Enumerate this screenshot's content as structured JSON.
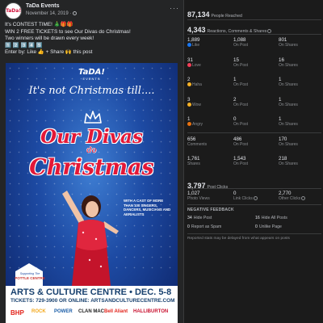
{
  "post": {
    "page_name": "TaDa Events",
    "avatar_text": "TaDa!",
    "date": "November 14, 2019 ·",
    "more": "···",
    "text_lines": [
      "It's CONTEST TIME! 🎄🎁🎁",
      "WIN 2 FREE TICKETS to see Our Divas do Christmas!",
      "Two winners will be drawn every week!",
      "1️⃣ 2️⃣ 3️⃣ 4️⃣ 5️⃣",
      "Enter by: Like 👍 + Share 🙌 this post"
    ]
  },
  "poster": {
    "logo": "TaDA!",
    "logo_sub": "EVENTS",
    "tagline": "It's not Christmas till....",
    "title_line1": "Our Divas",
    "title_line2": "do",
    "title_line3": "Christmas",
    "cast": "With a cast of more than 100 singers, dancers, musicians and aerialists",
    "support_label": "Supporting The",
    "sponsor_name": "POTTLE CENTRE",
    "venue": "ARTS & CULTURE CENTRE • DEC. 5-8",
    "tickets": "TICKETS: 729-3900 OR ONLINE: ARTSANDCULTURECENTRE.COM",
    "sponsors": [
      "BHP",
      "ROCK",
      "POWER",
      "CLAN MAC",
      "Bell Aliant",
      "HALLIBURTON"
    ],
    "colors": {
      "title_red": "#e31837",
      "navy": "#17406e",
      "sky_top": "#3f7fd4"
    }
  },
  "insights": {
    "people_reached": {
      "value": "87,134",
      "label": "People Reached"
    },
    "reactions": {
      "value": "4,343",
      "label": "Reactions, Comments & Shares"
    },
    "reaction_rows": [
      {
        "icon": "like-icon",
        "color": "#1877f2",
        "total": "1,889",
        "total_label": "Like",
        "on_post": "1,088",
        "on_post_label": "On Post",
        "on_shares": "801",
        "on_shares_label": "On Shares"
      },
      {
        "icon": "love-icon",
        "color": "#f33e58",
        "total": "31",
        "total_label": "Love",
        "on_post": "15",
        "on_post_label": "On Post",
        "on_shares": "16",
        "on_shares_label": "On Shares"
      },
      {
        "icon": "haha-icon",
        "color": "#f7b125",
        "total": "2",
        "total_label": "Haha",
        "on_post": "1",
        "on_post_label": "On Post",
        "on_shares": "1",
        "on_shares_label": "On Shares"
      },
      {
        "icon": "wow-icon",
        "color": "#f7b125",
        "total": "3",
        "total_label": "Wow",
        "on_post": "2",
        "on_post_label": "On Post",
        "on_shares": "1",
        "on_shares_label": "On Shares"
      },
      {
        "icon": "angry-icon",
        "color": "#e9710f",
        "total": "1",
        "total_label": "Angry",
        "on_post": "0",
        "on_post_label": "On Post",
        "on_shares": "1",
        "on_shares_label": "On Shares"
      },
      {
        "icon": "",
        "color": "",
        "total": "656",
        "total_label": "Comments",
        "on_post": "486",
        "on_post_label": "On Post",
        "on_shares": "170",
        "on_shares_label": "On Shares"
      },
      {
        "icon": "",
        "color": "",
        "total": "1,761",
        "total_label": "Shares",
        "on_post": "1,543",
        "on_post_label": "On Post",
        "on_shares": "218",
        "on_shares_label": "On Shares"
      }
    ],
    "post_clicks": {
      "value": "3,797",
      "label": "Post Clicks"
    },
    "click_cols": [
      {
        "value": "1,027",
        "label": "Photo Views"
      },
      {
        "value": "0",
        "label": "Link Clicks"
      },
      {
        "value": "2,770",
        "label": "Other Clicks"
      }
    ],
    "negative_title": "NEGATIVE FEEDBACK",
    "negative": [
      {
        "value": "34",
        "label": "Hide Post"
      },
      {
        "value": "16",
        "label": "Hide All Posts"
      },
      {
        "value": "0",
        "label": "Report as Spam"
      },
      {
        "value": "0",
        "label": "Unlike Page"
      }
    ],
    "disclaimer": "Reported stats may be delayed from what appears on posts"
  }
}
